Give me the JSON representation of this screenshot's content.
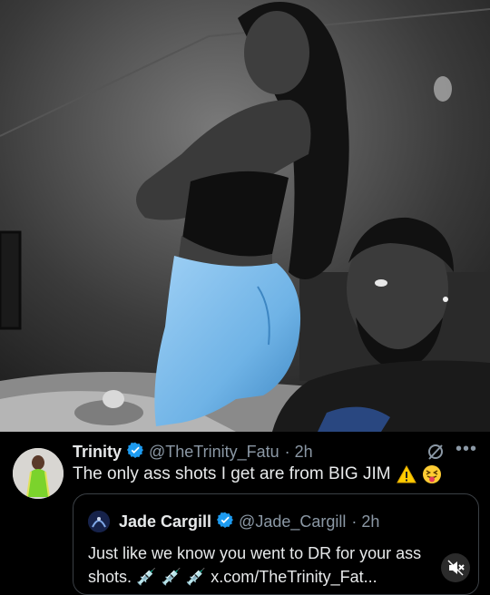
{
  "post": {
    "author_name": "Trinity",
    "author_handle": "@TheTrinity_Fatu",
    "time": "· 2h",
    "text": "The only ass shots I get are from BIG JIM",
    "more_label": "•••"
  },
  "quoted": {
    "author_name": "Jade Cargill",
    "author_handle": "@Jade_Cargill",
    "time": "· 2h",
    "text_line1": "Just like we know you went to DR for your ass",
    "text_line2": "shots. 💉 💉 💉 x.com/TheTrinity_Fat..."
  },
  "icons": {
    "verified": "verified-badge-icon",
    "grok": "grok-icon",
    "more": "more-options-icon",
    "warning": "warning-emoji-icon",
    "tongue": "squinting-tongue-emoji-icon",
    "mute": "mute-icon"
  },
  "colors": {
    "background": "#000000",
    "text": "#e7e9ea",
    "secondary_text": "#8b98a5",
    "verified_blue": "#1d9bf0",
    "jeans_blue": "#6fb3e6",
    "border": "#3b4045"
  }
}
